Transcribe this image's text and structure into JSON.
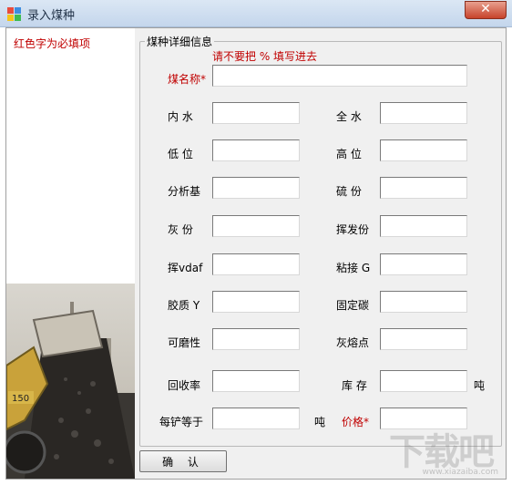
{
  "window": {
    "title": "录入煤种",
    "close_glyph": "✕",
    "accent_close": "#c7432b"
  },
  "left_note": "红色字为必填项",
  "group": {
    "title": "煤种详细信息",
    "warning": "请不要把 % 填写进去"
  },
  "fields": {
    "coal_name": {
      "label": "煤名称*",
      "value": ""
    },
    "total_moisture_inner": {
      "label": "内  水",
      "value": ""
    },
    "total_moisture": {
      "label": "全  水",
      "value": ""
    },
    "low_heat": {
      "label": "低  位",
      "value": ""
    },
    "high_heat": {
      "label": "高  位",
      "value": ""
    },
    "analysis_base": {
      "label": "分析基",
      "value": ""
    },
    "sulfur": {
      "label": "硫  份",
      "value": ""
    },
    "ash": {
      "label": "灰  份",
      "value": ""
    },
    "volatile": {
      "label": "挥发份",
      "value": ""
    },
    "vdaf": {
      "label": "挥vdaf",
      "value": ""
    },
    "caking": {
      "label": "粘接 G",
      "value": ""
    },
    "colloid": {
      "label": "胶质 Y",
      "value": ""
    },
    "fixed_carbon": {
      "label": "固定碳",
      "value": ""
    },
    "grindability": {
      "label": "可磨性",
      "value": ""
    },
    "ash_fusion": {
      "label": "灰熔点",
      "value": ""
    },
    "recovery": {
      "label": "回收率",
      "value": ""
    },
    "stock": {
      "label": "库 存",
      "value": "",
      "unit": "吨"
    },
    "per_ton": {
      "label": "每铲等于",
      "value": "",
      "unit": "吨"
    },
    "price": {
      "label": "价格*",
      "value": ""
    }
  },
  "confirm_button": "确 认",
  "watermark": {
    "logo": "下载吧",
    "url": "www.xiazaiba.com"
  },
  "colors": {
    "required": "#c00000",
    "client_bg": "#f0f0f0"
  }
}
